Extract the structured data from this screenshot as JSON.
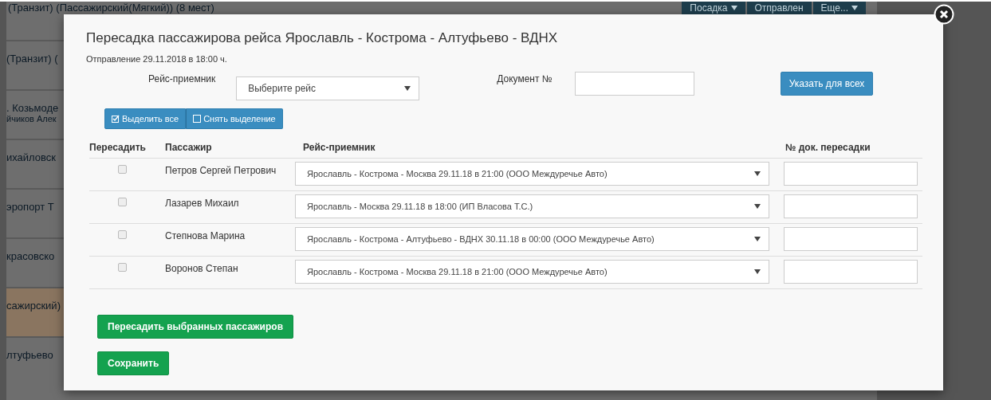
{
  "background": {
    "top_row_text": "(Транзит) (Пассажирский(Мягкий)) (8 мест)",
    "top_buttons": [
      {
        "label": "Посадка",
        "caret": true
      },
      {
        "label": "Отправлен",
        "caret": false
      },
      {
        "label": "Еще...",
        "caret": true
      }
    ],
    "left_rows": [
      {
        "lines": [
          "(Транзит) ("
        ],
        "highlighted": false
      },
      {
        "lines": [
          ". Козьмоде",
          "йчиков Алек"
        ],
        "highlighted": false
      },
      {
        "lines": [
          "ихайловск"
        ],
        "highlighted": false
      },
      {
        "lines": [
          "эропорт Т"
        ],
        "highlighted": false
      },
      {
        "lines": [
          "красовско"
        ],
        "highlighted": false
      },
      {
        "lines": [
          "сажирский)"
        ],
        "highlighted": true
      },
      {
        "lines": [
          "лтуфьево"
        ],
        "highlighted": false
      }
    ]
  },
  "modal": {
    "title": "Пересадка пассажирова рейса Ярославль - Кострома - Алтуфьево - ВДНХ",
    "departure": "Отправление 29.11.2018 в 18:00 ч.",
    "trip_label": "Рейс-приемник",
    "trip_select": "Выберите рейс",
    "document_label": "Документ №",
    "apply_all_button": "Указать для всех",
    "select_all_button": "Выделить все",
    "deselect_button": "Снять выделение",
    "table": {
      "columns": [
        "Пересадить",
        "Пассажир",
        "Рейс-приемник",
        "№ док. пересадки"
      ],
      "rows": [
        {
          "checked": false,
          "passenger": "Петров Сергей Петрович",
          "trip": "Ярославль - Кострома - Москва 29.11.18 в 21:00 (ООО Междуречье Авто)"
        },
        {
          "checked": false,
          "passenger": "Лазарев Михаил",
          "trip": "Ярославль - Москва 29.11.18 в 18:00 (ИП Власова Т.С.)"
        },
        {
          "checked": false,
          "passenger": "Степнова Марина",
          "trip": "Ярославль - Кострома - Алтуфьево - ВДНХ 30.11.18 в 00:00 (ООО Междуречье Авто)"
        },
        {
          "checked": false,
          "passenger": "Воронов Степан",
          "trip": "Ярославль - Кострома - Москва 29.11.18 в 21:00 (ООО Междуречье Авто)"
        }
      ]
    },
    "transfer_button": "Пересадить выбранных пассажиров",
    "save_button": "Сохранить"
  }
}
